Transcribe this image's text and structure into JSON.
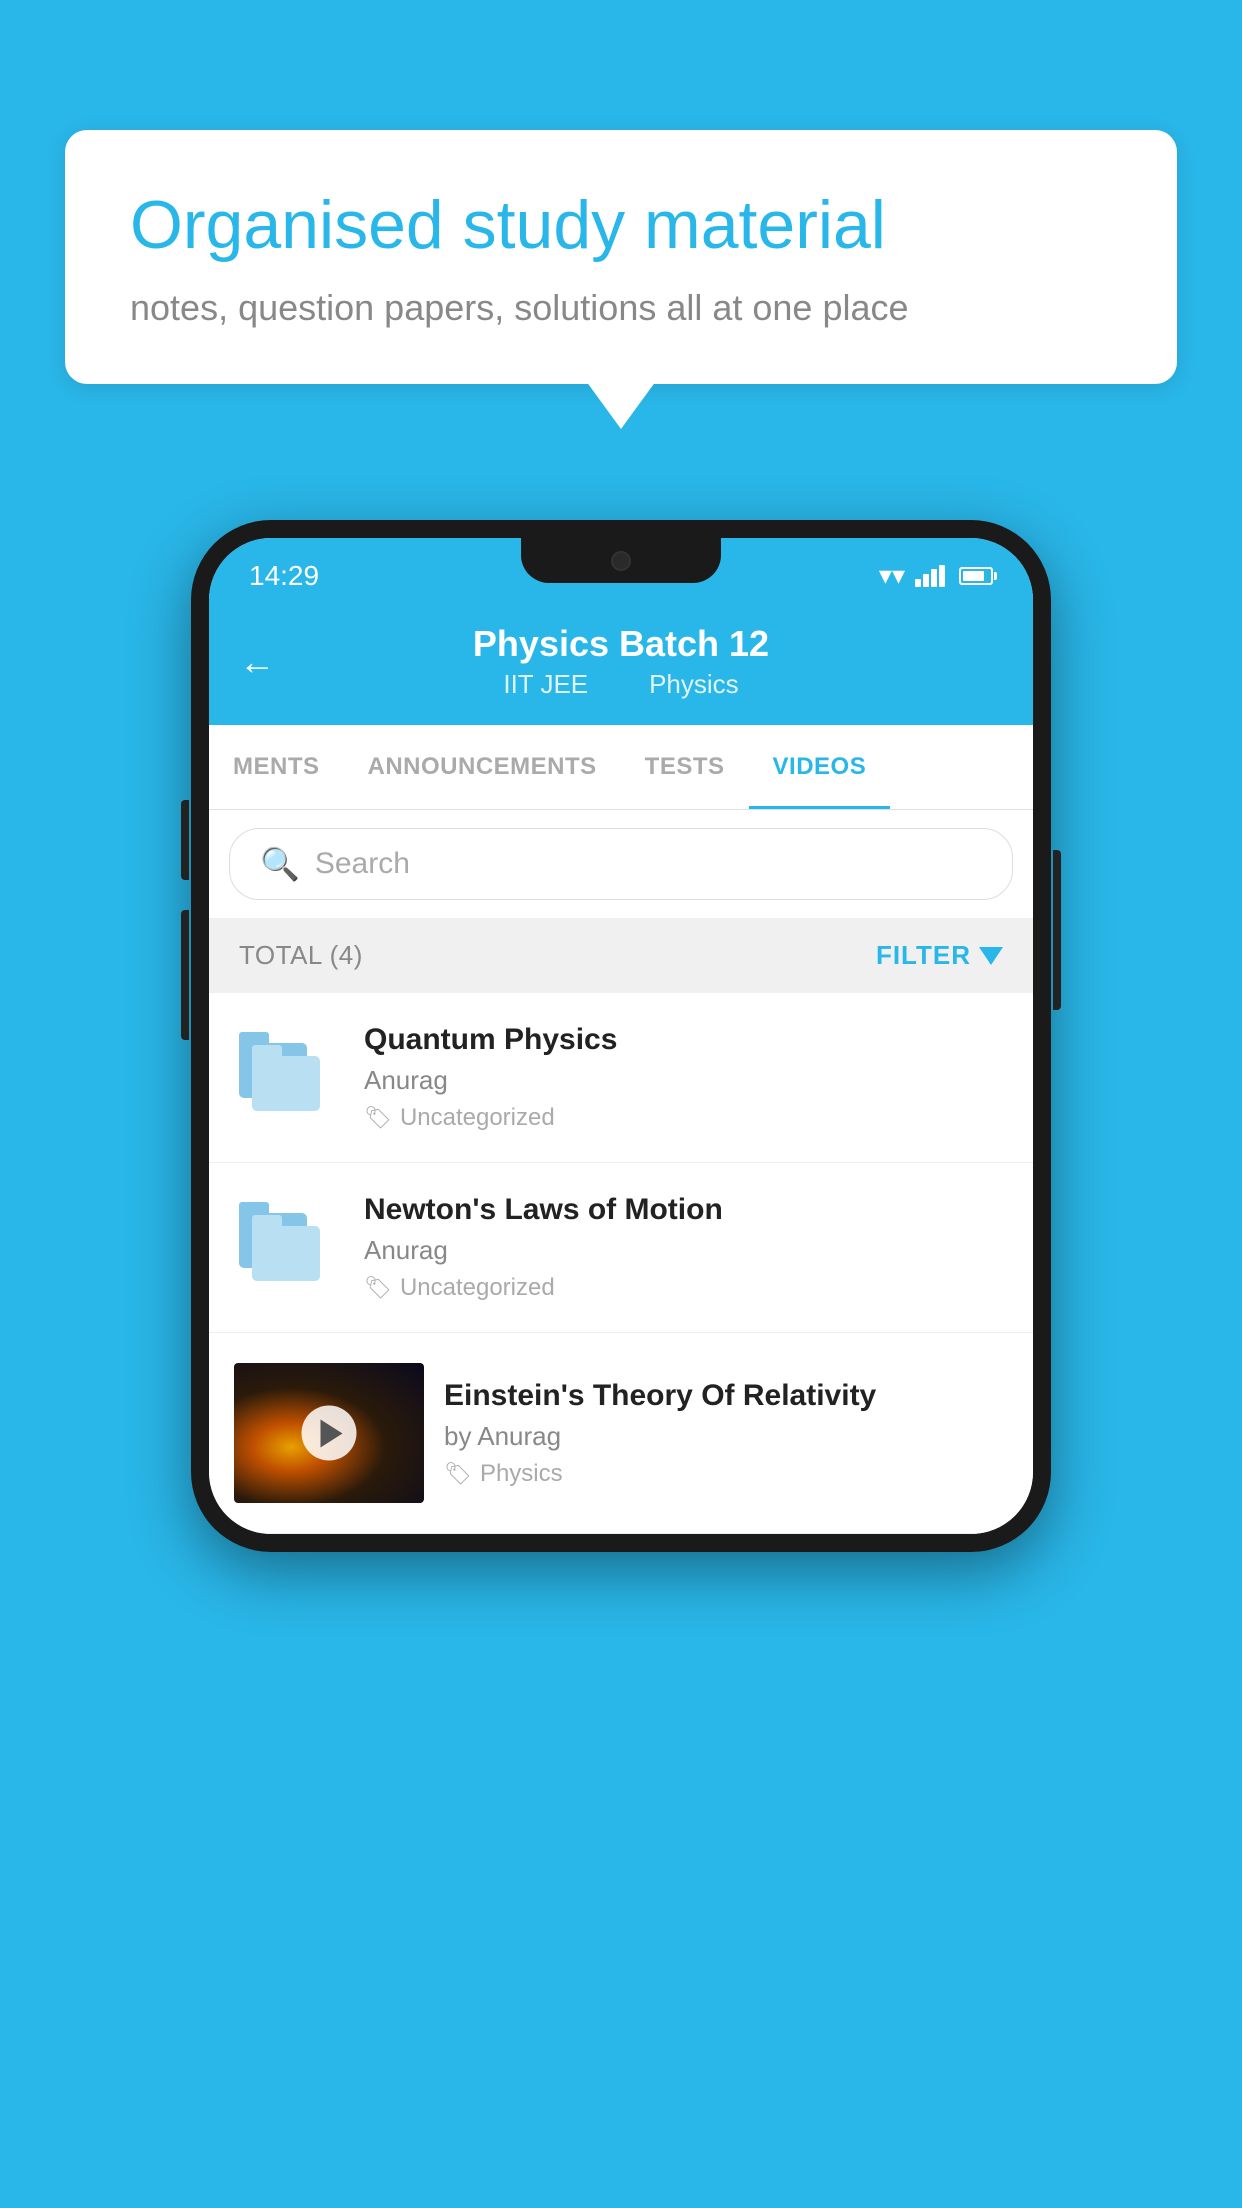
{
  "background_color": "#29B6E8",
  "speech_bubble": {
    "title": "Organised study material",
    "subtitle": "notes, question papers, solutions all at one place"
  },
  "phone": {
    "status_bar": {
      "time": "14:29"
    },
    "header": {
      "title": "Physics Batch 12",
      "subtitle1": "IIT JEE",
      "subtitle2": "Physics",
      "back_label": "←"
    },
    "tabs": [
      {
        "label": "MENTS",
        "active": false
      },
      {
        "label": "ANNOUNCEMENTS",
        "active": false
      },
      {
        "label": "TESTS",
        "active": false
      },
      {
        "label": "VIDEOS",
        "active": true
      }
    ],
    "search": {
      "placeholder": "Search"
    },
    "filter_bar": {
      "total_label": "TOTAL (4)",
      "filter_label": "FILTER"
    },
    "videos": [
      {
        "id": 1,
        "title": "Quantum Physics",
        "author": "Anurag",
        "tag": "Uncategorized",
        "has_thumbnail": false
      },
      {
        "id": 2,
        "title": "Newton's Laws of Motion",
        "author": "Anurag",
        "tag": "Uncategorized",
        "has_thumbnail": false
      },
      {
        "id": 3,
        "title": "Einstein's Theory Of Relativity",
        "author": "by Anurag",
        "tag": "Physics",
        "has_thumbnail": true
      }
    ]
  }
}
